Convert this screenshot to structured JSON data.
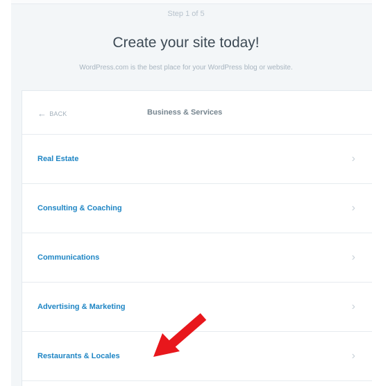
{
  "signup": {
    "step": "Step 1 of 5",
    "title": "Create your site today!",
    "subtitle": "WordPress.com is the best place for your WordPress blog or website."
  },
  "card": {
    "back_label": "BACK",
    "header_title": "Business & Services",
    "items": [
      {
        "label": "Real Estate"
      },
      {
        "label": "Consulting & Coaching"
      },
      {
        "label": "Communications"
      },
      {
        "label": "Advertising & Marketing"
      },
      {
        "label": "Restaurants & Locales"
      }
    ]
  },
  "colors": {
    "link": "#1e85c4",
    "annotation": "#e8171c"
  },
  "icons": {
    "back": "arrow-left-icon",
    "row": "chevron-right-icon",
    "annotation": "red-arrow-annotation-icon"
  }
}
